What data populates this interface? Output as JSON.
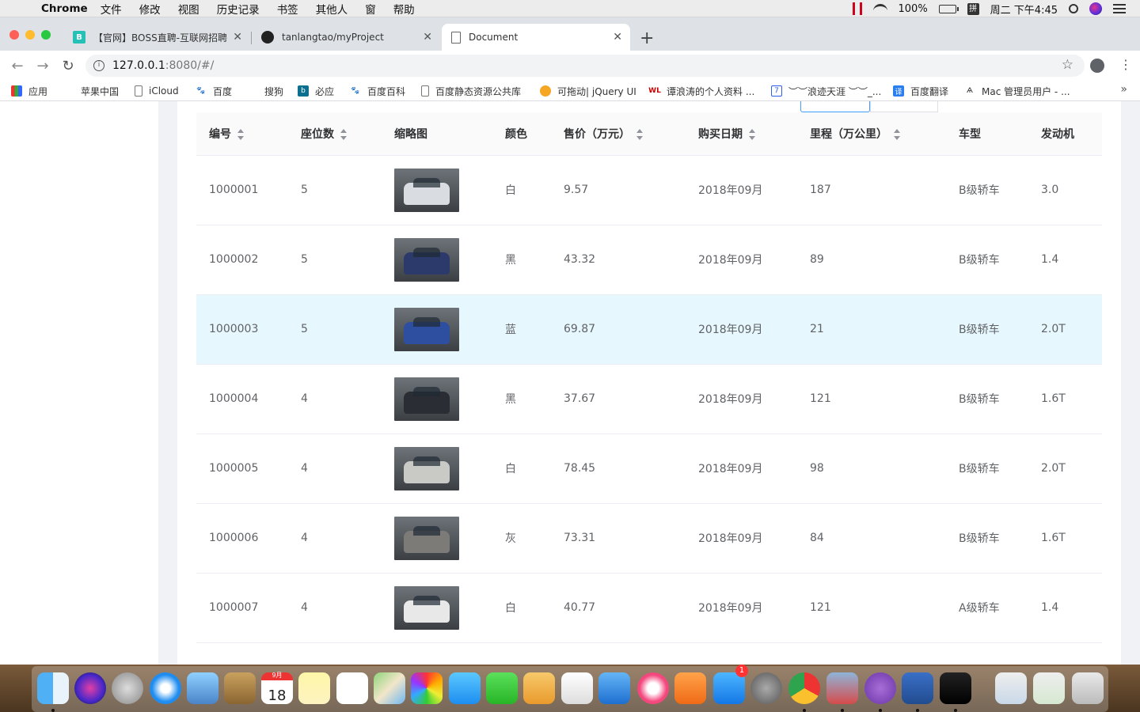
{
  "menubar": {
    "app_name": "Chrome",
    "items": [
      "文件",
      "修改",
      "视图",
      "历史记录",
      "书签",
      "其他人",
      "窗",
      "帮助"
    ],
    "battery": "100%",
    "ime": "拼",
    "clock": "周二 下午4:45"
  },
  "tabs": [
    {
      "title": "【官网】BOSS直聘-互联网招聘",
      "icon": "boss-favicon"
    },
    {
      "title": "tanlangtao/myProject",
      "icon": "github-favicon"
    },
    {
      "title": "Document",
      "icon": "document-favicon"
    }
  ],
  "address": {
    "host": "127.0.0.1",
    "rest": ":8080/#/"
  },
  "bookmarks": [
    "应用",
    "苹果中国",
    "iCloud",
    "百度",
    "搜狗",
    "必应",
    "百度百科",
    "百度静态资源公共库",
    "可拖动| jQuery UI",
    "谭浪涛的个人资料 ...",
    "︶︶浪迹天涯 ︶︶_...",
    "百度翻译",
    "Mac 管理员用户 - ..."
  ],
  "table": {
    "headers": {
      "id": "编号",
      "seats": "座位数",
      "thumb": "缩略图",
      "color": "颜色",
      "price": "售价（万元）",
      "date": "购买日期",
      "mileage": "里程（万公里）",
      "type": "车型",
      "engine": "发动机"
    },
    "rows": [
      {
        "id": "1000001",
        "seats": "5",
        "color": "白",
        "price": "9.57",
        "date": "2018年09月",
        "mileage": "187",
        "type": "B级轿车",
        "engine": "3.0",
        "car_color": "#d9dde2"
      },
      {
        "id": "1000002",
        "seats": "5",
        "color": "黑",
        "price": "43.32",
        "date": "2018年09月",
        "mileage": "89",
        "type": "B级轿车",
        "engine": "1.4",
        "car_color": "#2b3a6b"
      },
      {
        "id": "1000003",
        "seats": "5",
        "color": "蓝",
        "price": "69.87",
        "date": "2018年09月",
        "mileage": "21",
        "type": "B级轿车",
        "engine": "2.0T",
        "car_color": "#2e4fa0"
      },
      {
        "id": "1000004",
        "seats": "4",
        "color": "黑",
        "price": "37.67",
        "date": "2018年09月",
        "mileage": "121",
        "type": "B级轿车",
        "engine": "1.6T",
        "car_color": "#2a2d33"
      },
      {
        "id": "1000005",
        "seats": "4",
        "color": "白",
        "price": "78.45",
        "date": "2018年09月",
        "mileage": "98",
        "type": "B级轿车",
        "engine": "2.0T",
        "car_color": "#c9c9c6"
      },
      {
        "id": "1000006",
        "seats": "4",
        "color": "灰",
        "price": "73.31",
        "date": "2018年09月",
        "mileage": "84",
        "type": "B级轿车",
        "engine": "1.6T",
        "car_color": "#7d7b78"
      },
      {
        "id": "1000007",
        "seats": "4",
        "color": "白",
        "price": "40.77",
        "date": "2018年09月",
        "mileage": "121",
        "type": "A级轿车",
        "engine": "1.4",
        "car_color": "#e8e8e8"
      }
    ]
  },
  "dock": {
    "calendar_month": "9月",
    "calendar_day": "18",
    "appstore_badge": "1"
  }
}
